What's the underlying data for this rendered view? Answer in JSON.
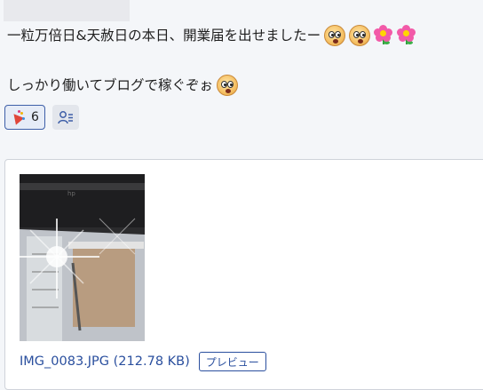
{
  "message": {
    "line1_text": "一粒万倍日&天赦日の本日、開業届を出せましたー",
    "line1_emojis": [
      "surprised-face-emoji",
      "surprised-face-emoji",
      "flower-emoji",
      "flower-emoji"
    ],
    "line2_text": "しっかり働いてブログで稼ぐぞぉ",
    "line2_emojis": [
      "surprised-face-emoji"
    ]
  },
  "reactions": {
    "party_count": "6",
    "party_icon": "party-popper-icon",
    "who_reacted_icon": "people-list-icon"
  },
  "attachment": {
    "file_name": "IMG_0083.JPG (212.78 KB)",
    "preview_label": "プレビュー"
  },
  "colors": {
    "link": "#2a4f9e",
    "chip_border": "#3e5fa8",
    "flower": "#f25aa8"
  }
}
